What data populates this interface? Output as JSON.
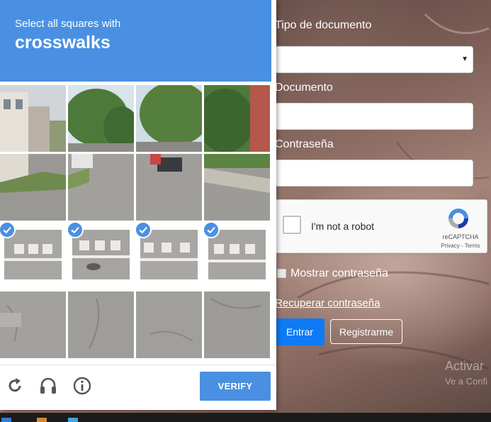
{
  "captcha": {
    "instruction_intro": "Select all squares with",
    "instruction_target": "crosswalks",
    "tiles_selected": [
      false,
      false,
      false,
      false,
      true,
      true,
      true,
      true,
      false,
      false,
      false,
      false
    ],
    "verify_label": "VERIFY",
    "icons": [
      "reload-icon",
      "audio-icon",
      "info-icon"
    ],
    "accent_color": "#4a90e2"
  },
  "form": {
    "doc_type_label": "Tipo de documento",
    "doc_label": "Documento",
    "password_label": "Contraseña",
    "recaptcha_label": "I'm not a robot",
    "recaptcha_brand": "reCAPTCHA",
    "recaptcha_terms": "Privacy - Terms",
    "show_password_label": "Mostrar contraseña",
    "recover_link": "Recuperar contraseña",
    "enter_button": "Entrar",
    "register_button": "Registrarme",
    "enter_color": "#0d7bf5"
  },
  "watermark": {
    "line1": "Activar",
    "line2": "Ve a Confi"
  }
}
